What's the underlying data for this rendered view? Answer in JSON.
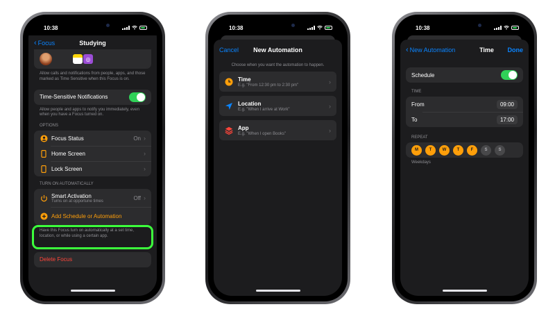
{
  "status": {
    "time": "10:38"
  },
  "screen1": {
    "back_label": "Focus",
    "title": "Studying",
    "allow_text": "Allow calls and notifications from people, apps, and those marked as Time Sensitive when this Focus is on.",
    "time_sensitive_label": "Time-Sensitive Notifications",
    "time_sensitive_on": true,
    "time_sensitive_foot": "Allow people and apps to notify you immediately, even when you have a Focus turned on.",
    "options_header": "OPTIONS",
    "options": [
      {
        "label": "Focus Status",
        "value": "On",
        "icon": "person-circle-icon"
      },
      {
        "label": "Home Screen",
        "value": "",
        "icon": "phone-icon"
      },
      {
        "label": "Lock Screen",
        "value": "",
        "icon": "phone-icon"
      }
    ],
    "auto_header": "TURN ON AUTOMATICALLY",
    "smart_label": "Smart Activation",
    "smart_sub": "Turns on at opportune times",
    "smart_value": "Off",
    "add_schedule_label": "Add Schedule or Automation",
    "add_foot": "Have this Focus turn on automatically at a set time, location, or while using a certain app.",
    "delete_label": "Delete Focus",
    "accent": "#ff9f0a",
    "destructive": "#ff453a",
    "highlight_color": "#3cff3c"
  },
  "screen2": {
    "cancel_label": "Cancel",
    "title": "New Automation",
    "prompt": "Choose when you want the automation to happen.",
    "items": [
      {
        "title": "Time",
        "sub": "E.g. \"From 12:30 pm to 2:30 pm\"",
        "icon": "clock-icon",
        "color": "#ff9f0a"
      },
      {
        "title": "Location",
        "sub": "E.g. \"When I arrive at Work\"",
        "icon": "location-arrow-icon",
        "color": "#0a84ff"
      },
      {
        "title": "App",
        "sub": "E.g. \"When I open Books\"",
        "icon": "app-stack-icon",
        "color": "#ff453a"
      }
    ]
  },
  "screen3": {
    "back_label": "New Automation",
    "title": "Time",
    "done_label": "Done",
    "schedule_label": "Schedule",
    "schedule_on": true,
    "time_header": "TIME",
    "from_label": "From",
    "from_value": "09:00",
    "to_label": "To",
    "to_value": "17:00",
    "repeat_header": "REPEAT",
    "days": [
      {
        "label": "M",
        "on": true
      },
      {
        "label": "T",
        "on": true
      },
      {
        "label": "W",
        "on": true
      },
      {
        "label": "T",
        "on": true
      },
      {
        "label": "F",
        "on": true
      },
      {
        "label": "S",
        "on": false
      },
      {
        "label": "S",
        "on": false
      }
    ],
    "repeat_summary": "Weekdays"
  }
}
